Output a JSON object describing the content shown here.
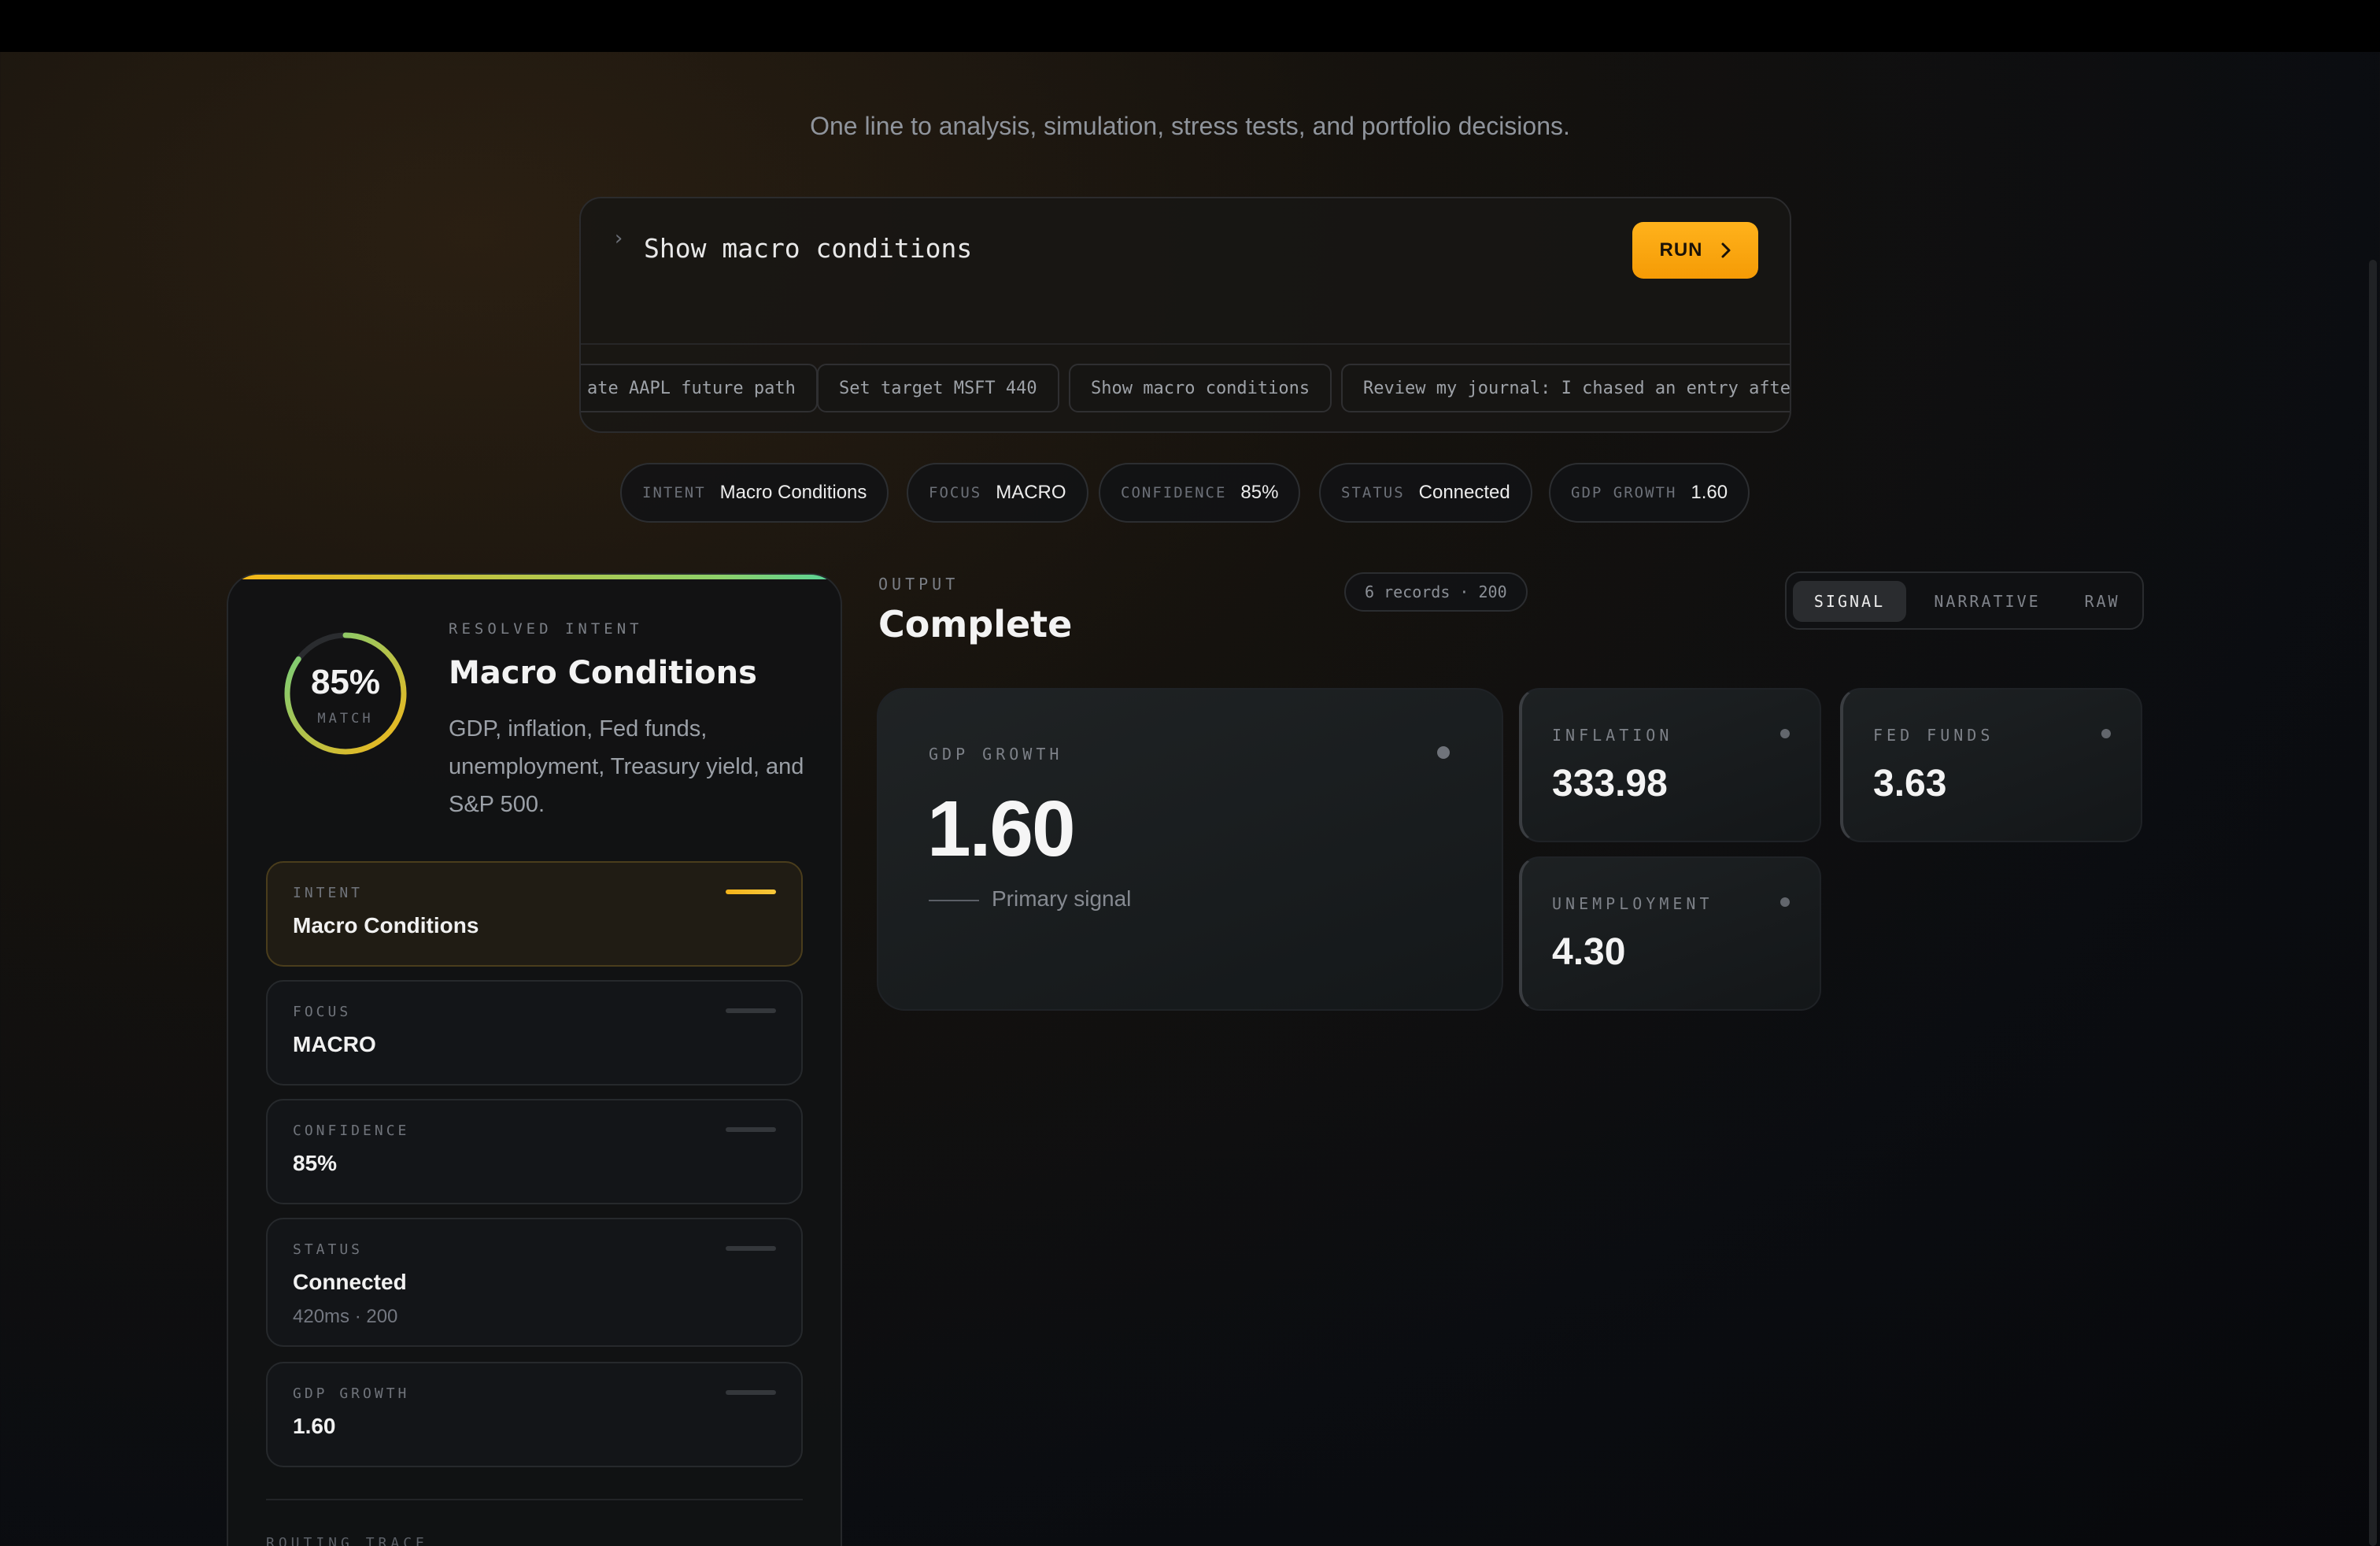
{
  "hero": {
    "subtitle": "One line to analysis, simulation, stress tests, and portfolio decisions."
  },
  "command": {
    "caret": "›",
    "value": "Show macro conditions",
    "run_label": "RUN",
    "run_icon": "chevron-right-icon",
    "suggestions": [
      "ate AAPL future path",
      "Set target MSFT 440",
      "Show macro conditions",
      "Review my journal: I chased an entry afte"
    ]
  },
  "pills": [
    {
      "key": "INTENT",
      "value": "Macro Conditions"
    },
    {
      "key": "FOCUS",
      "value": "MACRO"
    },
    {
      "key": "CONFIDENCE",
      "value": "85%"
    },
    {
      "key": "STATUS",
      "value": "Connected"
    },
    {
      "key": "GDP GROWTH",
      "value": "1.60"
    }
  ],
  "resolved": {
    "match_pct": "85%",
    "match_value": 0.85,
    "match_label": "MATCH",
    "label": "RESOLVED INTENT",
    "title": "Macro Conditions",
    "description": "GDP, inflation, Fed funds, unemployment, Treasury yield, and S&P 500.",
    "rows": [
      {
        "key": "INTENT",
        "value": "Macro Conditions",
        "sub": ""
      },
      {
        "key": "FOCUS",
        "value": "MACRO",
        "sub": ""
      },
      {
        "key": "CONFIDENCE",
        "value": "85%",
        "sub": ""
      },
      {
        "key": "STATUS",
        "value": "Connected",
        "sub": "420ms · 200"
      },
      {
        "key": "GDP GROWTH",
        "value": "1.60",
        "sub": ""
      }
    ],
    "routing_label": "ROUTING TRACE"
  },
  "output": {
    "label": "OUTPUT",
    "title": "Complete",
    "records": "6 records · 200",
    "tabs": [
      "SIGNAL",
      "NARRATIVE",
      "RAW"
    ],
    "active_tab": "SIGNAL",
    "primary": {
      "key": "GDP GROWTH",
      "value": "1.60",
      "sub": "Primary signal"
    },
    "metrics": [
      {
        "key": "INFLATION",
        "value": "333.98"
      },
      {
        "key": "FED FUNDS",
        "value": "3.63"
      },
      {
        "key": "UNEMPLOYMENT",
        "value": "4.30"
      }
    ]
  },
  "colors": {
    "accent": "#f7a80d",
    "gauge_start": "#f5b617",
    "gauge_end": "#6fcf7f"
  }
}
